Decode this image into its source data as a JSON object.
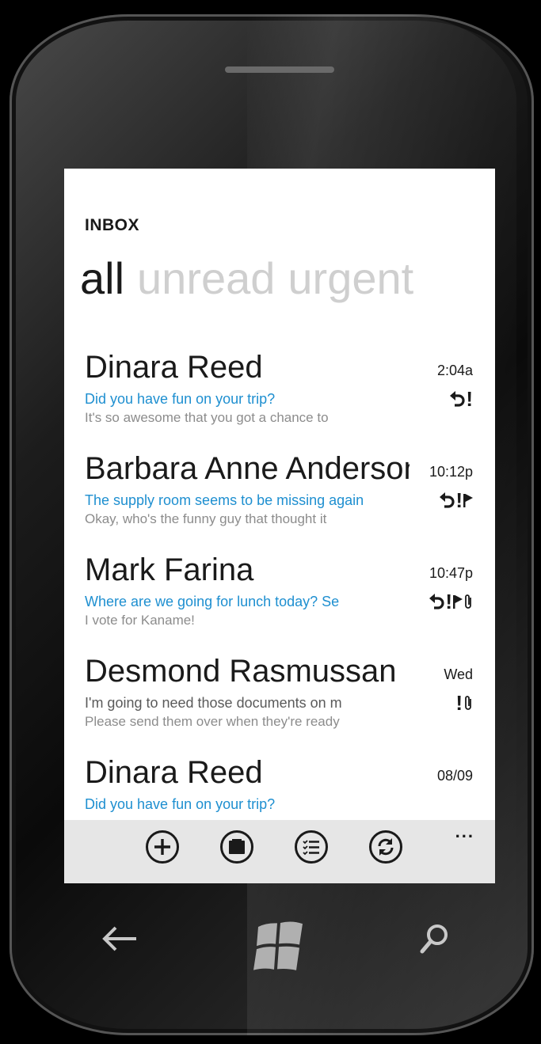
{
  "header": {
    "title": "INBOX"
  },
  "pivots": [
    {
      "label": "all",
      "active": true
    },
    {
      "label": "unread",
      "active": false
    },
    {
      "label": "urgent",
      "active": false
    }
  ],
  "messages": [
    {
      "sender": "Dinara Reed",
      "subject": "Did you have fun on your trip?",
      "preview": "It's so awesome that you got a chance to",
      "time": "2:04a",
      "icons": [
        "reply-icon",
        "urgent-icon"
      ],
      "unread": true
    },
    {
      "sender": "Barbara Anne Anderson",
      "subject": "The supply room seems to be missing again",
      "preview": "Okay, who's the funny guy that thought it",
      "time": "10:12p",
      "icons": [
        "reply-icon",
        "urgent-icon",
        "flag-icon"
      ],
      "unread": true
    },
    {
      "sender": "Mark Farina",
      "subject": "Where are we going for lunch today? Se",
      "preview": "I vote for Kaname!",
      "time": "10:47p",
      "icons": [
        "reply-icon",
        "urgent-icon",
        "flag-icon",
        "attachment-icon"
      ],
      "unread": true
    },
    {
      "sender": "Desmond Rasmussan",
      "subject": "I'm going to need those documents on m",
      "preview": "Please send them over when they're ready",
      "time": "Wed",
      "icons": [
        "urgent-icon",
        "attachment-icon"
      ],
      "unread": false
    },
    {
      "sender": "Dinara Reed",
      "subject": "Did you have fun on your trip?",
      "preview": "",
      "time": "08/09",
      "icons": [],
      "unread": true
    }
  ],
  "appbar": {
    "buttons": [
      "new-icon",
      "folders-icon",
      "select-icon",
      "sync-icon"
    ],
    "more_label": "..."
  },
  "hardware_buttons": [
    "back-arrow-icon",
    "windows-start-icon",
    "search-icon"
  ],
  "colors": {
    "accent": "#1e8fd0",
    "appbar_bg": "#e6e6e6",
    "text": "#1a1a1a",
    "secondary_text": "#8c8c8c"
  }
}
